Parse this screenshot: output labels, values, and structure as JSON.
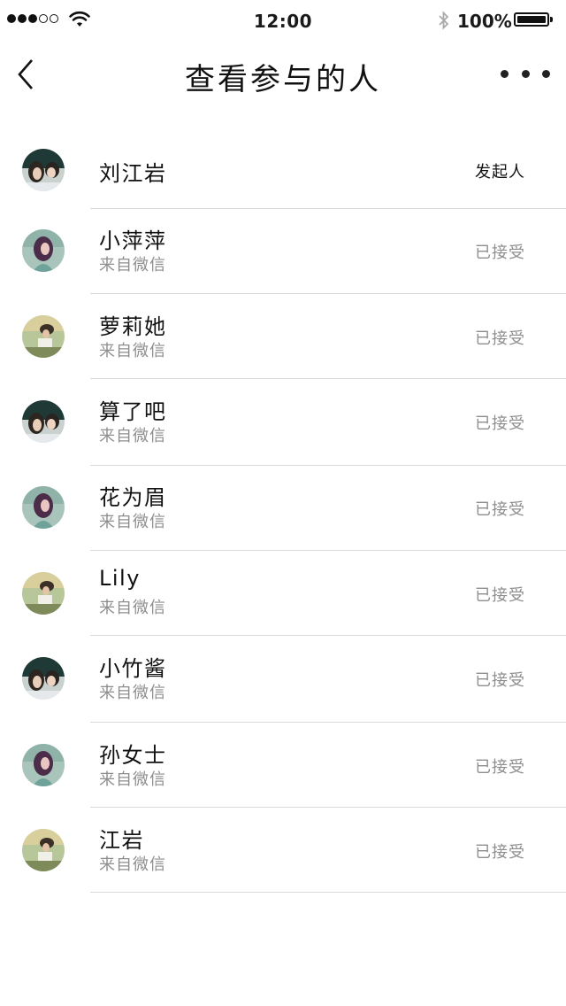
{
  "status_bar": {
    "time": "12:00",
    "battery": "100%",
    "signal_icon": "signal-dots-icon",
    "wifi_icon": "wifi-icon",
    "bluetooth_icon": "bluetooth-icon",
    "battery_icon": "battery-icon"
  },
  "nav": {
    "title": "查看参与的人",
    "back_icon": "chevron-left-icon",
    "more_icon": "more-dots-icon"
  },
  "participants": [
    {
      "name": "刘江岩",
      "source": "",
      "status": "发起人",
      "avatar": "couple-photo"
    },
    {
      "name": "小萍萍",
      "source": "来自微信",
      "status": "已接受",
      "avatar": "girl-photo"
    },
    {
      "name": "萝莉她",
      "source": "来自微信",
      "status": "已接受",
      "avatar": "bench-photo"
    },
    {
      "name": "算了吧",
      "source": "来自微信",
      "status": "已接受",
      "avatar": "couple-photo"
    },
    {
      "name": "花为眉",
      "source": "来自微信",
      "status": "已接受",
      "avatar": "girl-photo"
    },
    {
      "name": "Lily",
      "source": "来自微信",
      "status": "已接受",
      "avatar": "bench-photo"
    },
    {
      "name": "小竹酱",
      "source": "来自微信",
      "status": "已接受",
      "avatar": "couple-photo"
    },
    {
      "name": "孙女士",
      "source": "来自微信",
      "status": "已接受",
      "avatar": "girl-photo"
    },
    {
      "name": "江岩",
      "source": "来自微信",
      "status": "已接受",
      "avatar": "bench-photo"
    }
  ]
}
